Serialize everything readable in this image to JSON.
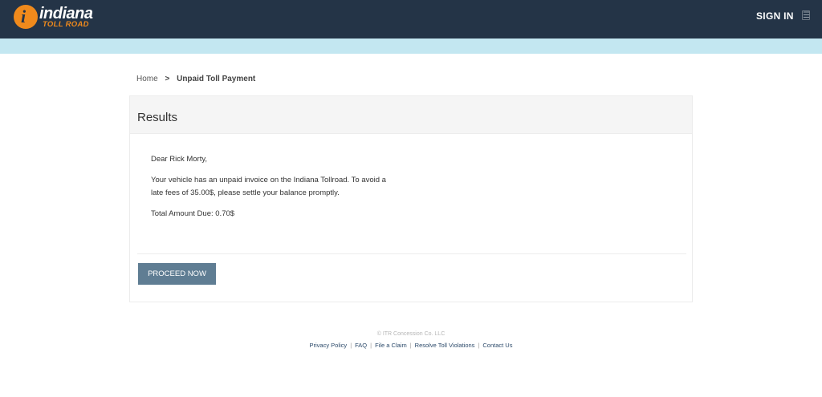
{
  "header": {
    "logo_word1": "indiana",
    "logo_word2": "TOLL ROAD",
    "logo_letter": "i",
    "signin_label": "SIGN IN",
    "menu_glyph": "☰"
  },
  "breadcrumb": {
    "home": "Home",
    "separator": ">",
    "current": "Unpaid Toll Payment"
  },
  "results": {
    "title": "Results",
    "greeting": "Dear Rick Morty,",
    "body": "Your vehicle has an unpaid invoice on the Indiana Tollroad. To avoid a late fees of 35.00$, please settle your balance promptly.",
    "total": "Total Amount Due: 0.70$",
    "proceed_label": "PROCEED NOW"
  },
  "footer": {
    "copyright": "© ITR Concession Co. LLC",
    "links": [
      "Privacy Policy",
      "FAQ",
      "File a Claim",
      "Resolve Toll Violations",
      "Contact Us"
    ],
    "pipe": "|"
  },
  "colors": {
    "topbar": "#243447",
    "accent_orange": "#f08a1c",
    "stripe": "#c3e7f1",
    "button": "#5f7d93"
  }
}
